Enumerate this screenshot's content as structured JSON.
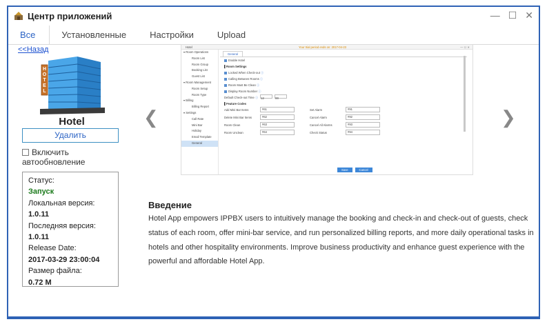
{
  "window": {
    "title": "Центр приложений",
    "controls": {
      "minimize": "—",
      "maximize": "☐",
      "close": "✕"
    }
  },
  "tabs": [
    {
      "label": "Все",
      "active": true
    },
    {
      "label": "Установленные",
      "active": false
    },
    {
      "label": "Настройки",
      "active": false
    },
    {
      "label": "Upload",
      "active": false
    }
  ],
  "back_link": "<<Назад",
  "app": {
    "name": "Hotel",
    "logo_text": "HOTEL",
    "uninstall_label": "Удалить",
    "autoupdate": {
      "label_line1": "Включить",
      "label_line2": "автообновление",
      "checked": false
    }
  },
  "info": {
    "status_label": "Статус:",
    "status_value": "Запуск",
    "local_version_label": "Локальная версия:",
    "local_version_value": "1.0.11",
    "latest_version_label": "Последняя версия:",
    "latest_version_value": "1.0.11",
    "release_date_label": "Release Date:",
    "release_date_value": "2017-03-29 23:00:04",
    "file_size_label": "Размер файла:",
    "file_size_value": "0.72 M"
  },
  "carousel": {
    "prev_icon": "chevron-left-icon",
    "next_icon": "chevron-right-icon",
    "prev_glyph": "❮",
    "next_glyph": "❯"
  },
  "screenshot": {
    "app_title": "Hotel",
    "notice": "Your trial period ends on: 2017-04-23",
    "sidebar": [
      {
        "label": "▾ Room Operations",
        "sub": false
      },
      {
        "label": "Room List",
        "sub": true
      },
      {
        "label": "Room Group",
        "sub": true
      },
      {
        "label": "Booking List",
        "sub": true
      },
      {
        "label": "Guest List",
        "sub": true
      },
      {
        "label": "▾ Room Management",
        "sub": false
      },
      {
        "label": "Room Setup",
        "sub": true
      },
      {
        "label": "Room Type",
        "sub": true
      },
      {
        "label": "▾ Billing",
        "sub": false
      },
      {
        "label": "Billing Report",
        "sub": true
      },
      {
        "label": "▾ Settings",
        "sub": false
      },
      {
        "label": "Call Rate",
        "sub": true
      },
      {
        "label": "Mini Bar",
        "sub": true
      },
      {
        "label": "Holiday",
        "sub": true
      },
      {
        "label": "Email Template",
        "sub": true
      },
      {
        "label": "General",
        "sub": true,
        "selected": true
      }
    ],
    "tab": "General",
    "enable_hotel": "Enable Hotel",
    "room_settings": "Room Settings",
    "options": [
      "Locked When Check-out",
      "Calling Between Rooms",
      "Room Must Be Clean",
      "Display Room Number"
    ],
    "checkout_time_label": "Default Check-out Time",
    "checkout_hour": "12",
    "checkout_min": "00",
    "feature_codes": "Feature Codes",
    "codes": [
      {
        "l": "Add Mini Bar Items",
        "v": "#61",
        "l2": "Set Alarm",
        "v2": "#91"
      },
      {
        "l": "Delete Mini Bar Items",
        "v": "#62",
        "l2": "Cancel Alarm",
        "v2": "#92"
      },
      {
        "l": "Room Clean",
        "v": "#63",
        "l2": "Cancel All Alarms",
        "v2": "#93"
      },
      {
        "l": "Room Unclean",
        "v": "#64",
        "l2": "Check Status",
        "v2": "#94"
      }
    ],
    "save": "Save",
    "cancel": "Cancel"
  },
  "intro": {
    "heading": "Введение",
    "text": "Hotel App empowers IPPBX users to intuitively manage the booking and check-in and check-out of guests, check status of each room, offer mini-bar service, and run personalized billing reports, and more daily operational tasks in hotels and other hospitality environments. Improve business productivity and enhance guest experience with the powerful and affordable Hotel App."
  },
  "colors": {
    "accent": "#2b63c4",
    "frame": "#2e62b5",
    "status_ok": "#1b7a1b",
    "link": "#1a4fd0"
  }
}
